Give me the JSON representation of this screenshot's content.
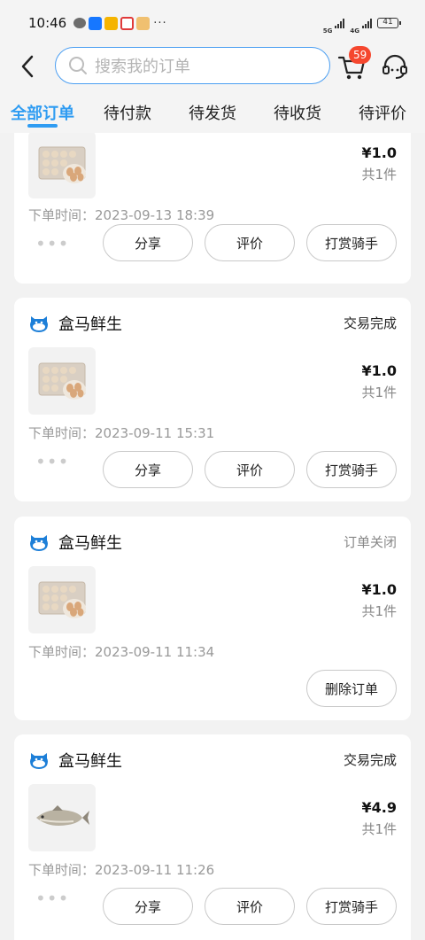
{
  "status_bar": {
    "time": "10:46",
    "more": "···",
    "net1": "5G",
    "net2": "4G",
    "battery": "41"
  },
  "search": {
    "placeholder": "搜索我的订单"
  },
  "cart": {
    "badge": "59"
  },
  "tabs": [
    {
      "label": "全部订单",
      "active": true
    },
    {
      "label": "待付款",
      "active": false
    },
    {
      "label": "待发货",
      "active": false
    },
    {
      "label": "待收货",
      "active": false
    },
    {
      "label": "待评价",
      "active": false
    }
  ],
  "orders": [
    {
      "store": "",
      "status": "",
      "item_image": "eggs",
      "price": "¥1.0",
      "qty": "共1件",
      "time": "下单时间：2023-09-13 18:39",
      "actions": [
        "分享",
        "评价",
        "打赏骑手"
      ]
    },
    {
      "store": "盒马鲜生",
      "status": "交易完成",
      "item_image": "eggs",
      "price": "¥1.0",
      "qty": "共1件",
      "time": "下单时间：2023-09-11 15:31",
      "actions": [
        "分享",
        "评价",
        "打赏骑手"
      ]
    },
    {
      "store": "盒马鲜生",
      "status": "订单关闭",
      "item_image": "eggs",
      "price": "¥1.0",
      "qty": "共1件",
      "time": "下单时间：2023-09-11 11:34",
      "actions": [
        "删除订单"
      ]
    },
    {
      "store": "盒马鲜生",
      "status": "交易完成",
      "item_image": "fish",
      "price": "¥4.9",
      "qty": "共1件",
      "time": "下单时间：2023-09-11 11:26",
      "actions": [
        "分享",
        "评价",
        "打赏骑手"
      ]
    }
  ],
  "colors": {
    "accent": "#2f9cf2",
    "badge": "#f5472e",
    "card": "#ffffff",
    "background": "#f2f2f2"
  }
}
